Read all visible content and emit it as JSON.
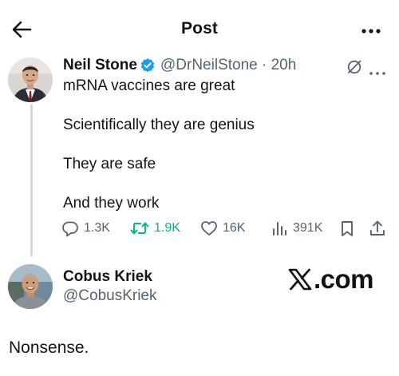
{
  "header": {
    "title": "Post",
    "back_icon": "arrow-left-icon",
    "more_icon": "more-horizontal-icon"
  },
  "tweet": {
    "author_name": "Neil Stone",
    "verified_icon": "verified-badge-icon",
    "handle_time": "@DrNeilStone · 20h",
    "lines": [
      "mRNA vaccines are great",
      "Scientifically they are genius",
      "They are safe",
      "And they work"
    ],
    "actions": {
      "replies": "1.3K",
      "reposts": "1.9K",
      "likes": "16K",
      "views": "391K"
    }
  },
  "reply": {
    "author_name": "Cobus Kriek",
    "handle": "@CobusKriek",
    "text": "Nonsense."
  },
  "watermark": {
    "text": ".com"
  },
  "colors": {
    "text": "#0f1419",
    "secondary": "#536471",
    "verified": "#1d9bf0",
    "repost": "#00ba7c",
    "thread_line": "#cfd9de"
  }
}
